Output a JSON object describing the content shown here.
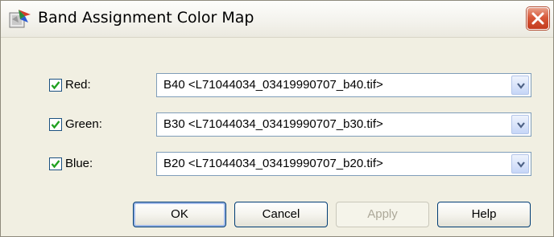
{
  "window": {
    "title": "Band Assignment Color Map"
  },
  "bands": [
    {
      "label": "Red:",
      "checked": true,
      "value": "B40 <L71044034_03419990707_b40.tif>"
    },
    {
      "label": "Green:",
      "checked": true,
      "value": "B30 <L71044034_03419990707_b30.tif>"
    },
    {
      "label": "Blue:",
      "checked": true,
      "value": "B20 <L71044034_03419990707_b20.tif>"
    }
  ],
  "buttons": {
    "ok": "OK",
    "cancel": "Cancel",
    "apply": "Apply",
    "help": "Help"
  },
  "colors": {
    "dialog_bg": "#f1efe2",
    "close_red": "#d8593a",
    "check_green": "#21a121",
    "border_blue": "#7f9db9"
  },
  "icons": {
    "app": "band-map-icon",
    "close": "close-icon",
    "check": "checkmark-icon",
    "dropdown": "chevron-down-icon"
  }
}
